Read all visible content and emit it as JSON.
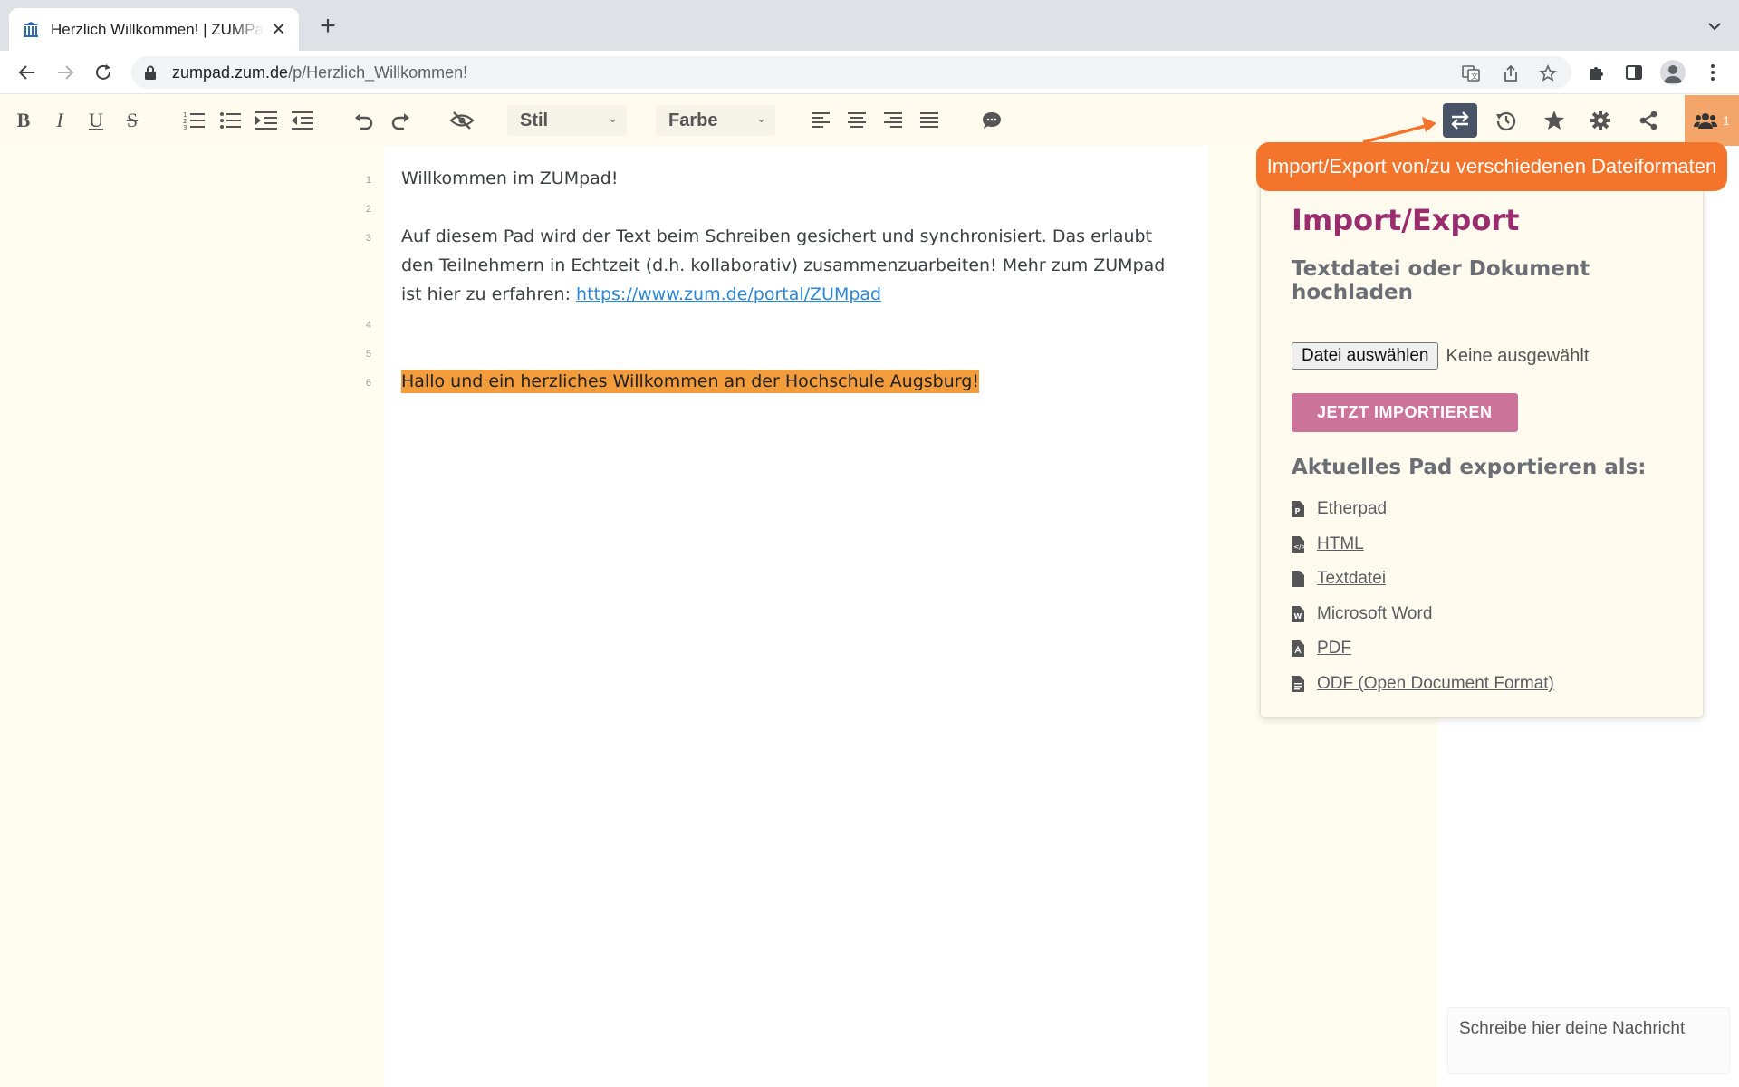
{
  "browser": {
    "tab_title": "Herzlich Willkommen! | ZUMPad",
    "url_domain": "zumpad.zum.de",
    "url_path": "/p/Herzlich_Willkommen!"
  },
  "toolbar": {
    "style_select": "Stil",
    "color_select": "Farbe",
    "user_count": "1"
  },
  "tooltip": {
    "text": "Import/Export von/zu verschiedenen Dateiformaten"
  },
  "editor": {
    "line_numbers": [
      "1",
      "2",
      "3",
      "4",
      "5",
      "6"
    ],
    "line1": "Willkommen im ZUMpad!",
    "line3": "Auf diesem Pad wird der Text beim Schreiben gesichert und synchronisiert. Das erlaubt den Teilnehmern in Echtzeit (d.h. kollaborativ) zusammenzuarbeiten! Mehr zum ZUMpad ist hier zu erfahren: ",
    "line3_link": "https://www.zum.de/portal/ZUMpad",
    "line6": "Hallo und ein herzliches Willkommen an der Hochschule Augsburg!"
  },
  "import_export": {
    "title": "Import/Export",
    "upload_heading": "Textdatei oder Dokument hochladen",
    "file_button": "Datei auswählen",
    "file_status": "Keine ausgewählt",
    "import_button": "JETZT IMPORTIEREN",
    "export_heading": "Aktuelles Pad exportieren als:",
    "export_options": [
      "Etherpad",
      "HTML",
      "Textdatei",
      "Microsoft Word",
      "PDF",
      "ODF (Open Document Format)"
    ]
  },
  "chat": {
    "input_placeholder": "Schreibe hier deine Nachricht"
  },
  "colors": {
    "highlight": "#f39c3c",
    "tooltip": "#f3742a",
    "popup_title": "#9a2d6e",
    "import_button": "#cc7399",
    "active_tool": "#485365"
  }
}
